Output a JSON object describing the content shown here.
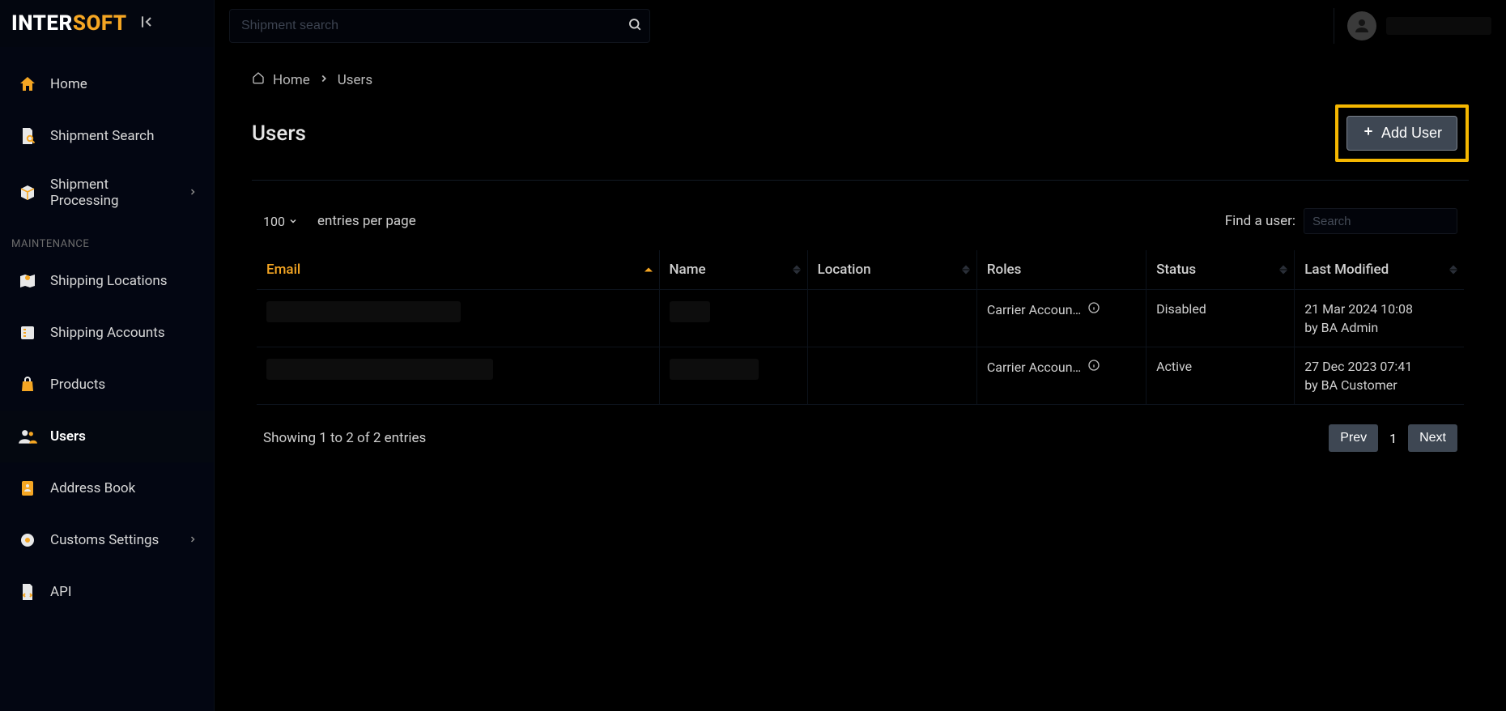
{
  "logo": {
    "part1": "INTER",
    "part2": "SOFT"
  },
  "topbar": {
    "search_placeholder": "Shipment search",
    "user_name": ""
  },
  "sidebar": {
    "items": [
      {
        "label": "Home",
        "icon": "home-icon"
      },
      {
        "label": "Shipment Search",
        "icon": "file-search-icon"
      },
      {
        "label": "Shipment Processing",
        "icon": "package-icon",
        "chevron": true
      }
    ],
    "section_label": "MAINTENANCE",
    "maint_items": [
      {
        "label": "Shipping Locations",
        "icon": "map-pin-icon"
      },
      {
        "label": "Shipping Accounts",
        "icon": "list-icon"
      },
      {
        "label": "Products",
        "icon": "bag-icon"
      },
      {
        "label": "Users",
        "icon": "users-icon",
        "active": true
      },
      {
        "label": "Address Book",
        "icon": "book-icon"
      },
      {
        "label": "Customs Settings",
        "icon": "gear-icon",
        "chevron": true
      },
      {
        "label": "API",
        "icon": "file-code-icon"
      }
    ]
  },
  "breadcrumb": {
    "home": "Home",
    "current": "Users"
  },
  "page": {
    "title": "Users",
    "add_button": "Add User"
  },
  "table_controls": {
    "page_size": "100",
    "entries_label": "entries per page",
    "find_label": "Find a user:",
    "find_placeholder": "Search"
  },
  "table": {
    "columns": [
      "Email",
      "Name",
      "Location",
      "Roles",
      "Status",
      "Last Modified"
    ],
    "sorted_column_index": 0,
    "rows": [
      {
        "email": "",
        "name": "",
        "location": "",
        "roles": "Carrier Accoun…",
        "status": "Disabled",
        "last_date": "21 Mar 2024 10:08",
        "last_by": "by BA Admin"
      },
      {
        "email": "",
        "name": "",
        "location": "",
        "roles": "Carrier Accoun…",
        "status": "Active",
        "last_date": "27 Dec 2023 07:41",
        "last_by": "by BA Customer"
      }
    ]
  },
  "footer": {
    "showing": "Showing 1 to 2 of 2 entries",
    "prev": "Prev",
    "page": "1",
    "next": "Next"
  }
}
